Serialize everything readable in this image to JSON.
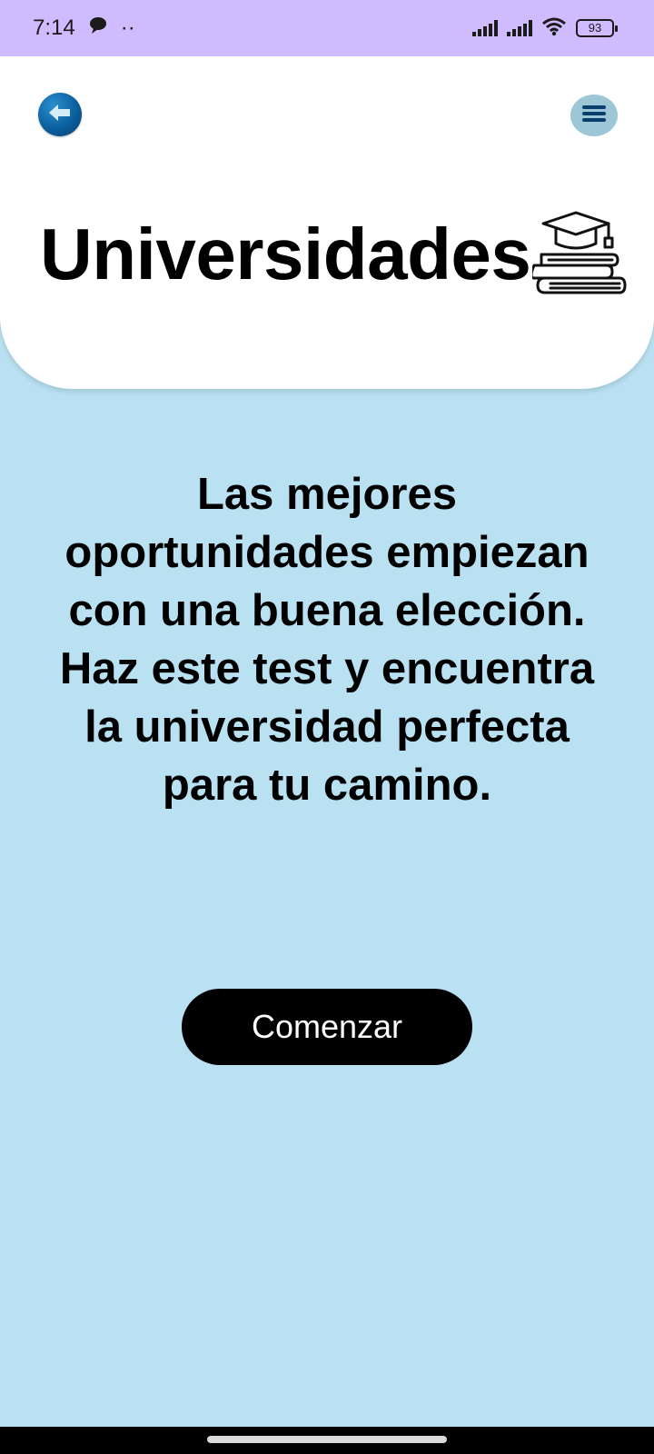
{
  "status_bar": {
    "time": "7:14",
    "extra_indicator": "··",
    "battery_level": "93",
    "icons": [
      "chat-bubble-icon",
      "signal-icon",
      "signal-icon",
      "wifi-icon",
      "battery-icon"
    ]
  },
  "header": {
    "title": "Universidades",
    "back_icon": "arrow-left-icon",
    "menu_icon": "hamburger-menu-icon",
    "title_icon": "graduation-cap-books-icon"
  },
  "main": {
    "intro_text": "Las mejores oportunidades empiezan con una buena elección. Haz este test y encuentra la universidad perfecta para tu camino.",
    "start_button_label": "Comenzar"
  },
  "colors": {
    "status_bar_bg": "#cfbcff",
    "page_bg": "#b9e1f2",
    "header_bg": "#ffffff",
    "button_bg": "#000000",
    "back_button": "#0b5f9e",
    "menu_button_bg": "#9dc7d6"
  }
}
